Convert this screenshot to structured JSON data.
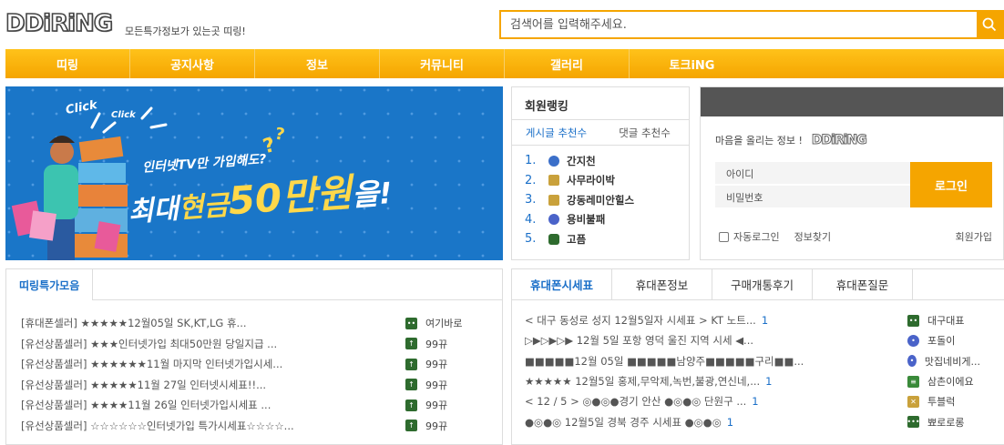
{
  "header": {
    "logo_text": "DDiRiNG",
    "tagline": "모든특가정보가 있는곳 띠링!",
    "search_placeholder": "검색어를 입력해주세요."
  },
  "nav": [
    "띠링",
    "공지사항",
    "정보",
    "커뮤니티",
    "갤러리",
    "토크iNG"
  ],
  "banner": {
    "click1": "Click",
    "click2": "Click",
    "line1": "인터넷TV만 가입해도?",
    "line2_a": "최대",
    "line2_b": "현금",
    "line2_c": "50만원",
    "line2_d": "을!"
  },
  "ranking": {
    "title": "회원랭킹",
    "tabs": [
      "게시글 추천수",
      "댓글 추천수"
    ],
    "items": [
      {
        "num": "1.",
        "name": "간지천",
        "color": "#3b6fc9"
      },
      {
        "num": "2.",
        "name": "사무라이박",
        "color": "#c9a13b"
      },
      {
        "num": "3.",
        "name": "강동레미안힐스",
        "color": "#c9a13b"
      },
      {
        "num": "4.",
        "name": "용비불패",
        "color": "#4a63c9"
      },
      {
        "num": "5.",
        "name": "고픔",
        "color": "#2e6b2e"
      }
    ]
  },
  "login": {
    "message": "마음을 올리는 정보 !",
    "logo_text": "DDiRiNG",
    "id_placeholder": "아이디",
    "pw_placeholder": "비밀번호",
    "login_btn": "로그인",
    "auto_login": "자동로그인",
    "find_info": "정보찾기",
    "join": "회원가입"
  },
  "deals": {
    "title": "띠링특가모음",
    "rows": [
      {
        "title": "[휴대폰셀러] ★★★★★12월05일 SK,KT,LG 휴...",
        "user": "여기바로",
        "icon_color": "#2e6b2e"
      },
      {
        "title": "[유선상품셀러] ★★★인터넷가입 최대50만원 당일지급 ...",
        "user": "99뀨",
        "icon_color": "#2e6b2e"
      },
      {
        "title": "[유선상품셀러] ★★★★★★11월 마지막 인터넷가입시세...",
        "user": "99뀨",
        "icon_color": "#2e6b2e"
      },
      {
        "title": "[유선상품셀러] ★★★★★11월 27일 인터넷시세표!!...",
        "user": "99뀨",
        "icon_color": "#2e6b2e"
      },
      {
        "title": "[유선상품셀러] ★★★★11월 26일 인터넷가입시세표 ...",
        "user": "99뀨",
        "icon_color": "#2e6b2e"
      },
      {
        "title": "[유선상품셀러] ☆☆☆☆☆☆인터넷가입 특가시세표☆☆☆☆...",
        "user": "99뀨",
        "icon_color": "#2e6b2e"
      }
    ]
  },
  "phone": {
    "tabs": [
      "휴대폰시세표",
      "휴대폰정보",
      "구매개통후기",
      "휴대폰질문"
    ],
    "rows": [
      {
        "title": "< 대구 동성로 성지 12월5일자 시세표 > KT 노트...",
        "count": "1",
        "user": "대구대표",
        "icon_color": "#2e6b2e"
      },
      {
        "title": "▷▶▷▶▷▶ 12월 5일 포항 영덕 울진 지역 시세 ◀...",
        "count": "",
        "user": "포돌이",
        "icon_color": "#4a63c9"
      },
      {
        "title": "■■■■■12월 05일 ■■■■■남양주■■■■■구리■■...",
        "count": "",
        "user": "맛집네비게...",
        "icon_color": "#4a63c9"
      },
      {
        "title": "★★★★★ 12월5일 홍제,무악제,녹번,불광,연신네,...",
        "count": "1",
        "user": "삼촌이에요",
        "icon_color": "#3a8a3a"
      },
      {
        "title": "< 12 / 5 > ◎●◎●경기 안산 ●◎●◎ 단원구 ...",
        "count": "1",
        "user": "투블럭",
        "icon_color": "#c9a13b"
      },
      {
        "title": "●◎●◎ 12월5일 경북 경주 시세표 ●◎●◎",
        "count": "1",
        "user": "뾰로로롱",
        "icon_color": "#2e6b2e"
      }
    ]
  },
  "colors": {
    "accent": "#f5a500",
    "blue": "#1a6fc8",
    "banner_bg": "#1a76c8"
  }
}
